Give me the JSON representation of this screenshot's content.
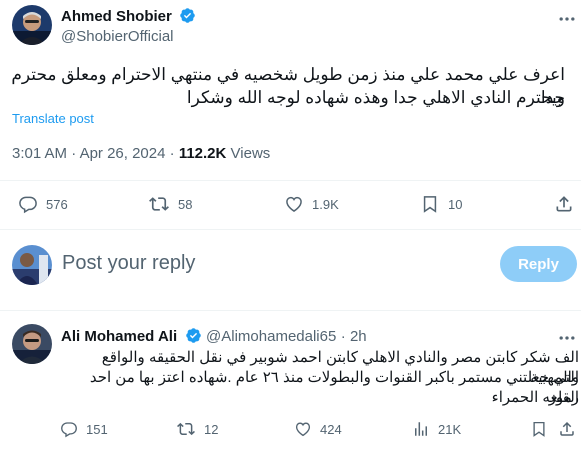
{
  "tweet": {
    "author_name": "Ahmed Shobier",
    "author_handle": "@ShobierOfficial",
    "text_line1": "اعرف علي محمد علي منذ زمن طويل شخصيه في منتهي الاحترام ومعلق محترم جدا",
    "text_line2": "ويحترم النادي الاهلي جدا وهذه شهاده لوجه الله وشكرا",
    "translate_label": "Translate post",
    "time": "3:01 AM",
    "date": "Apr 26, 2024",
    "views_count": "112.2K",
    "views_label": "Views",
    "replies": "576",
    "reposts": "58",
    "likes": "1.9K",
    "bookmarks": "10"
  },
  "composer": {
    "placeholder": "Post your reply",
    "reply_button": "Reply"
  },
  "reply": {
    "author_name": "Ali Mohamed Ali",
    "author_handle": "@Alimohamedali65",
    "time_ago": "2h",
    "text_line1": "الف شكر كابتن مصر والنادي الاهلي كابتن احمد شوبير في نقل الحقيقه والواقع والمهنية",
    "text_line2": "التي جعلتني مستمر باكبر القنوات والبطولات منذ ٢٦ عام .شهاده اعتز بها من احد رموز",
    "text_line3": "القلعه الحمراء",
    "replies": "151",
    "reposts": "12",
    "likes": "424",
    "views": "21K"
  },
  "colors": {
    "accent": "#1d9bf0",
    "reply_button_disabled": "#8ecdf8",
    "secondary_text": "#536471",
    "verified": "#1d9bf0"
  }
}
